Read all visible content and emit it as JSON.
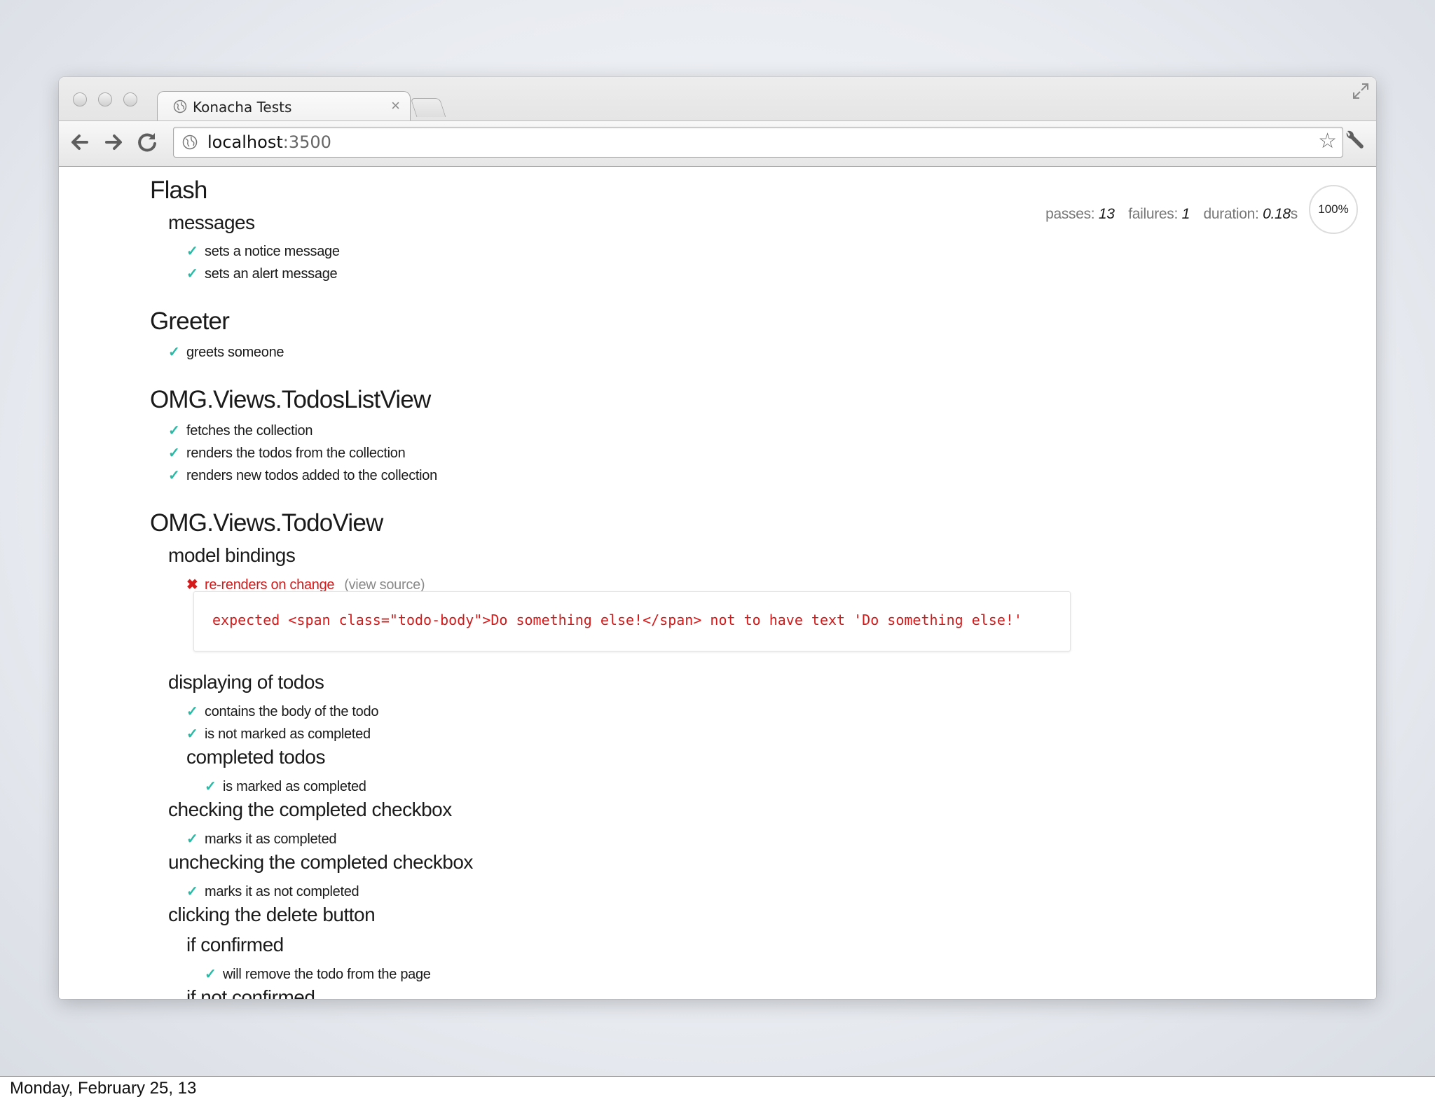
{
  "browser": {
    "tab_title": "Konacha Tests",
    "tab_close": "×",
    "url_host": "localhost",
    "url_port": ":3500"
  },
  "stats": {
    "passes_label": "passes:",
    "passes": "13",
    "failures_label": "failures:",
    "failures": "1",
    "duration_label": "duration:",
    "duration": "0.18",
    "duration_unit": "s",
    "progress": "100%"
  },
  "specs": {
    "flash": {
      "title": "Flash",
      "messages": {
        "title": "messages",
        "tests": [
          "sets a notice message",
          "sets an alert message"
        ]
      }
    },
    "greeter": {
      "title": "Greeter",
      "tests": [
        "greets someone"
      ]
    },
    "todos_list_view": {
      "title": "OMG.Views.TodosListView",
      "tests": [
        "fetches the collection",
        "renders the todos from the collection",
        "renders new todos added to the collection"
      ]
    },
    "todo_view": {
      "title": "OMG.Views.TodoView",
      "model_bindings": {
        "title": "model bindings",
        "failed_test": "re-renders on change",
        "view_source": "(view source)",
        "error": "expected <span class=\"todo-body\">Do something else!</span> not to have text 'Do something else!'"
      },
      "displaying": {
        "title": "displaying of todos",
        "tests": [
          "contains the body of the todo",
          "is not marked as completed"
        ],
        "completed": {
          "title": "completed todos",
          "tests": [
            "is marked as completed"
          ]
        }
      },
      "checking": {
        "title": "checking the completed checkbox",
        "tests": [
          "marks it as completed"
        ]
      },
      "unchecking": {
        "title": "unchecking the completed checkbox",
        "tests": [
          "marks it as not completed"
        ]
      },
      "delete": {
        "title": "clicking the delete button",
        "if_confirmed": {
          "title": "if confirmed",
          "tests": [
            "will remove the todo from the page"
          ]
        },
        "if_not_confirmed": {
          "title": "if not confirmed"
        }
      }
    }
  },
  "icons": {
    "check": "✓",
    "cross": "✖"
  },
  "colors": {
    "pass": "#2bb9a5",
    "fail": "#d41a1a"
  },
  "footer": {
    "date": "Monday, February 25, 13"
  }
}
